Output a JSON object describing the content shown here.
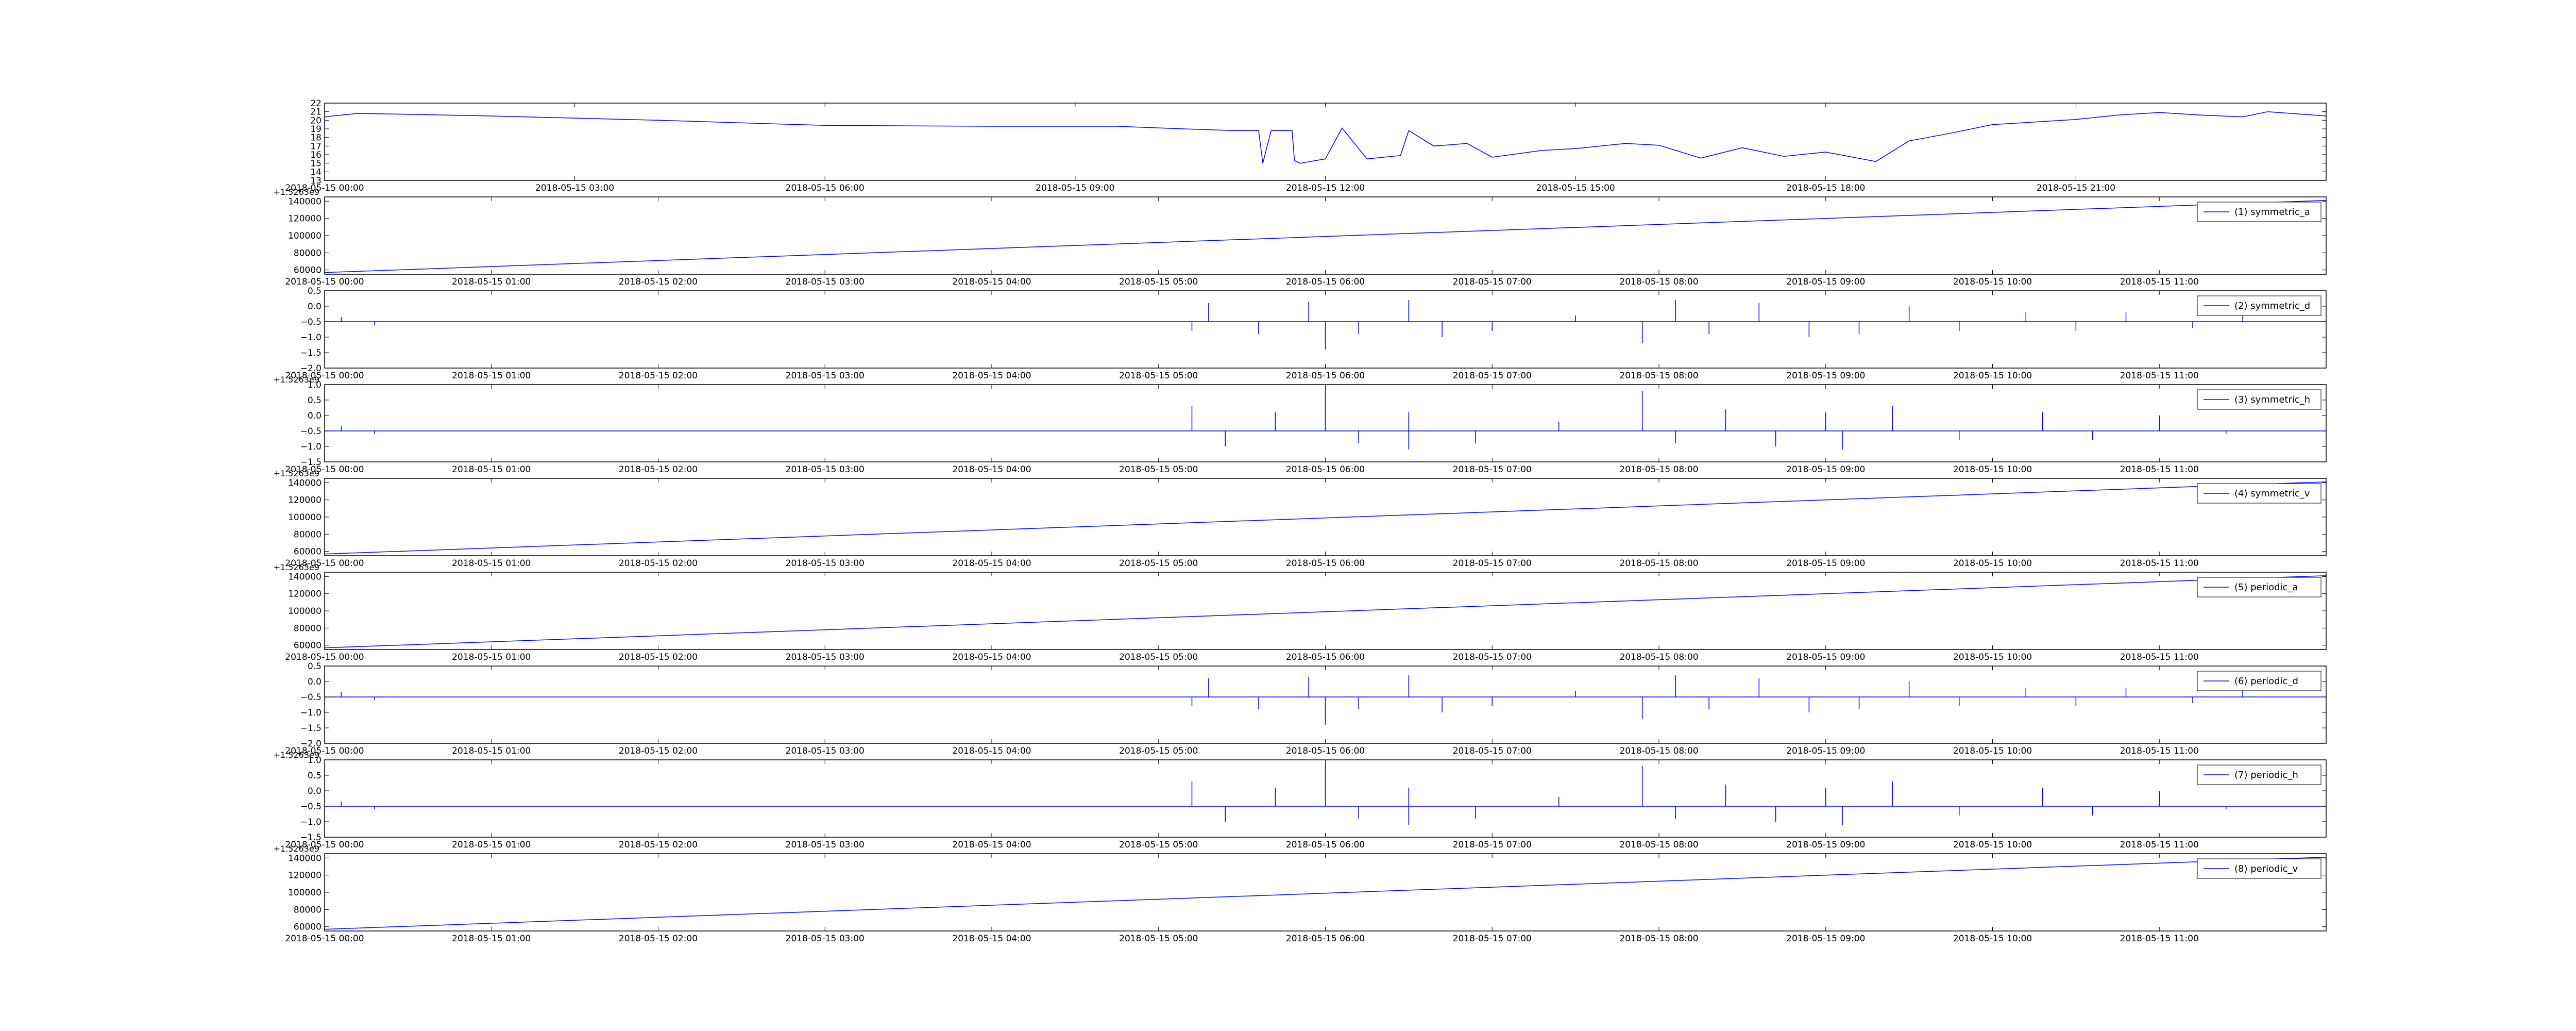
{
  "chart_data": [
    {
      "type": "line",
      "color": "#0000ff",
      "yticks": [
        "13",
        "14",
        "15",
        "16",
        "17",
        "18",
        "19",
        "20",
        "21",
        "22"
      ],
      "ylim": [
        13,
        22
      ],
      "xticks": [
        "2018-05-15 00:00",
        "2018-05-15 03:00",
        "2018-05-15 06:00",
        "2018-05-15 09:00",
        "2018-05-15 12:00",
        "2018-05-15 15:00",
        "2018-05-15 18:00",
        "2018-05-15 21:00"
      ],
      "x_hours": [
        0,
        24
      ],
      "offset_text": "",
      "series": [
        {
          "x": [
            0,
            0.4,
            1,
            2,
            4,
            6,
            8,
            9.5,
            10.3,
            10.9,
            11.2,
            11.25,
            11.35,
            11.6,
            11.63,
            11.7,
            12,
            12.2,
            12.5,
            12.9,
            13,
            13.3,
            13.7,
            14,
            14.6,
            15,
            15.6,
            16,
            16.5,
            17,
            17.5,
            18,
            18.6,
            19,
            19.5,
            20,
            20.5,
            21,
            21.5,
            22,
            22.5,
            23,
            23.3,
            24
          ],
          "y": [
            20.4,
            20.8,
            20.7,
            20.5,
            20.0,
            19.4,
            19.3,
            19.3,
            19.0,
            18.8,
            18.8,
            15.0,
            18.8,
            18.8,
            15.3,
            15.0,
            15.5,
            19.1,
            15.5,
            15.9,
            18.8,
            17.0,
            17.3,
            15.7,
            16.5,
            16.7,
            17.3,
            17.1,
            15.6,
            16.8,
            15.8,
            16.3,
            15.2,
            17.6,
            18.5,
            19.5,
            19.8,
            20.1,
            20.6,
            20.9,
            20.6,
            20.4,
            21.0,
            20.5
          ]
        }
      ],
      "legend": ""
    },
    {
      "type": "line",
      "color": "#0000ff",
      "yticks": [
        "60000",
        "80000",
        "100000",
        "120000",
        "140000"
      ],
      "ylim": [
        55000,
        145000
      ],
      "xticks": [
        "2018-05-15 00:00",
        "2018-05-15 01:00",
        "2018-05-15 02:00",
        "2018-05-15 03:00",
        "2018-05-15 04:00",
        "2018-05-15 05:00",
        "2018-05-15 06:00",
        "2018-05-15 07:00",
        "2018-05-15 08:00",
        "2018-05-15 09:00",
        "2018-05-15 10:00",
        "2018-05-15 11:00"
      ],
      "x_hours": [
        0,
        12
      ],
      "offset_text": "+1.5263e9",
      "series": [
        {
          "name": "(1) symmetric_a",
          "x": [
            0,
            12
          ],
          "y": [
            57000,
            141000
          ]
        }
      ],
      "legend": "(1) symmetric_a"
    },
    {
      "type": "line",
      "color": "#0000ff",
      "yticks": [
        "0.5",
        "0.0",
        "−0.5",
        "−1.0",
        "−1.5",
        "−2.0"
      ],
      "ylim": [
        -2.0,
        0.5
      ],
      "xticks": [
        "2018-05-15 00:00",
        "2018-05-15 01:00",
        "2018-05-15 02:00",
        "2018-05-15 03:00",
        "2018-05-15 04:00",
        "2018-05-15 05:00",
        "2018-05-15 06:00",
        "2018-05-15 07:00",
        "2018-05-15 08:00",
        "2018-05-15 09:00",
        "2018-05-15 10:00",
        "2018-05-15 11:00"
      ],
      "x_hours": [
        0,
        12
      ],
      "offset_text": "",
      "series": [
        {
          "name": "(2) symmetric_d",
          "x": [
            0,
            12
          ],
          "y": [
            -0.5,
            -0.5
          ]
        }
      ],
      "spikes": [
        [
          0.1,
          -0.35
        ],
        [
          0.3,
          -0.6
        ],
        [
          5.2,
          -0.8
        ],
        [
          5.3,
          0.1
        ],
        [
          5.6,
          -0.9
        ],
        [
          5.9,
          0.15
        ],
        [
          6.0,
          -1.4
        ],
        [
          6.2,
          -0.9
        ],
        [
          6.5,
          0.2
        ],
        [
          6.7,
          -1.0
        ],
        [
          7.0,
          -0.8
        ],
        [
          7.5,
          -0.3
        ],
        [
          7.9,
          -1.2
        ],
        [
          8.1,
          0.2
        ],
        [
          8.3,
          -0.9
        ],
        [
          8.6,
          0.1
        ],
        [
          8.9,
          -1.0
        ],
        [
          9.2,
          -0.9
        ],
        [
          9.5,
          0.0
        ],
        [
          9.8,
          -0.8
        ],
        [
          10.2,
          -0.2
        ],
        [
          10.5,
          -0.8
        ],
        [
          10.8,
          -0.2
        ],
        [
          11.2,
          -0.7
        ],
        [
          11.5,
          -0.3
        ]
      ],
      "legend": "(2) symmetric_d"
    },
    {
      "type": "line",
      "color": "#0000ff",
      "yticks": [
        "1.0",
        "0.5",
        "0.0",
        "−0.5",
        "−1.0",
        "−1.5"
      ],
      "ylim": [
        -1.5,
        1.0
      ],
      "xticks": [
        "2018-05-15 00:00",
        "2018-05-15 01:00",
        "2018-05-15 02:00",
        "2018-05-15 03:00",
        "2018-05-15 04:00",
        "2018-05-15 05:00",
        "2018-05-15 06:00",
        "2018-05-15 07:00",
        "2018-05-15 08:00",
        "2018-05-15 09:00",
        "2018-05-15 10:00",
        "2018-05-15 11:00"
      ],
      "x_hours": [
        0,
        12
      ],
      "offset_text": "+1.5263e9",
      "series": [
        {
          "name": "(3) symmetric_h",
          "x": [
            0,
            12
          ],
          "y": [
            -0.5,
            -0.5
          ]
        }
      ],
      "spikes": [
        [
          0.1,
          -0.35
        ],
        [
          0.3,
          -0.6
        ],
        [
          5.2,
          0.3
        ],
        [
          5.4,
          -1.0
        ],
        [
          5.7,
          0.1
        ],
        [
          6.0,
          0.9
        ],
        [
          6.2,
          -0.9
        ],
        [
          6.5,
          0.1
        ],
        [
          6.5,
          -1.1
        ],
        [
          6.9,
          -0.9
        ],
        [
          7.4,
          -0.2
        ],
        [
          7.9,
          0.8
        ],
        [
          8.1,
          -0.9
        ],
        [
          8.4,
          0.2
        ],
        [
          8.7,
          -1.0
        ],
        [
          9.0,
          0.1
        ],
        [
          9.1,
          -1.1
        ],
        [
          9.4,
          0.3
        ],
        [
          9.8,
          -0.8
        ],
        [
          10.3,
          0.1
        ],
        [
          10.6,
          -0.8
        ],
        [
          11.0,
          0.0
        ],
        [
          11.4,
          -0.6
        ]
      ],
      "legend": "(3) symmetric_h"
    },
    {
      "type": "line",
      "color": "#0000ff",
      "yticks": [
        "60000",
        "80000",
        "100000",
        "120000",
        "140000"
      ],
      "ylim": [
        55000,
        145000
      ],
      "xticks": [
        "2018-05-15 00:00",
        "2018-05-15 01:00",
        "2018-05-15 02:00",
        "2018-05-15 03:00",
        "2018-05-15 04:00",
        "2018-05-15 05:00",
        "2018-05-15 06:00",
        "2018-05-15 07:00",
        "2018-05-15 08:00",
        "2018-05-15 09:00",
        "2018-05-15 10:00",
        "2018-05-15 11:00"
      ],
      "x_hours": [
        0,
        12
      ],
      "offset_text": "+1.5263e9",
      "series": [
        {
          "name": "(4) symmetric_v",
          "x": [
            0,
            12
          ],
          "y": [
            57000,
            141000
          ]
        }
      ],
      "legend": "(4) symmetric_v"
    },
    {
      "type": "line",
      "color": "#0000ff",
      "yticks": [
        "60000",
        "80000",
        "100000",
        "120000",
        "140000"
      ],
      "ylim": [
        55000,
        145000
      ],
      "xticks": [
        "2018-05-15 00:00",
        "2018-05-15 01:00",
        "2018-05-15 02:00",
        "2018-05-15 03:00",
        "2018-05-15 04:00",
        "2018-05-15 05:00",
        "2018-05-15 06:00",
        "2018-05-15 07:00",
        "2018-05-15 08:00",
        "2018-05-15 09:00",
        "2018-05-15 10:00",
        "2018-05-15 11:00"
      ],
      "x_hours": [
        0,
        12
      ],
      "offset_text": "+1.5263e9",
      "series": [
        {
          "name": "(5) periodic_a",
          "x": [
            0,
            12
          ],
          "y": [
            57000,
            141000
          ]
        }
      ],
      "legend": "(5) periodic_a"
    },
    {
      "type": "line",
      "color": "#0000ff",
      "yticks": [
        "0.5",
        "0.0",
        "−0.5",
        "−1.0",
        "−1.5",
        "−2.0"
      ],
      "ylim": [
        -2.0,
        0.5
      ],
      "xticks": [
        "2018-05-15 00:00",
        "2018-05-15 01:00",
        "2018-05-15 02:00",
        "2018-05-15 03:00",
        "2018-05-15 04:00",
        "2018-05-15 05:00",
        "2018-05-15 06:00",
        "2018-05-15 07:00",
        "2018-05-15 08:00",
        "2018-05-15 09:00",
        "2018-05-15 10:00",
        "2018-05-15 11:00"
      ],
      "x_hours": [
        0,
        12
      ],
      "offset_text": "",
      "series": [
        {
          "name": "(6) periodic_d",
          "x": [
            0,
            12
          ],
          "y": [
            -0.5,
            -0.5
          ]
        }
      ],
      "spikes": [
        [
          0.1,
          -0.35
        ],
        [
          0.3,
          -0.6
        ],
        [
          5.2,
          -0.8
        ],
        [
          5.3,
          0.1
        ],
        [
          5.6,
          -0.9
        ],
        [
          5.9,
          0.15
        ],
        [
          6.0,
          -1.4
        ],
        [
          6.2,
          -0.9
        ],
        [
          6.5,
          0.2
        ],
        [
          6.7,
          -1.0
        ],
        [
          7.0,
          -0.8
        ],
        [
          7.5,
          -0.3
        ],
        [
          7.9,
          -1.2
        ],
        [
          8.1,
          0.2
        ],
        [
          8.3,
          -0.9
        ],
        [
          8.6,
          0.1
        ],
        [
          8.9,
          -1.0
        ],
        [
          9.2,
          -0.9
        ],
        [
          9.5,
          0.0
        ],
        [
          9.8,
          -0.8
        ],
        [
          10.2,
          -0.2
        ],
        [
          10.5,
          -0.8
        ],
        [
          10.8,
          -0.2
        ],
        [
          11.2,
          -0.7
        ],
        [
          11.5,
          -0.3
        ]
      ],
      "legend": "(6) periodic_d"
    },
    {
      "type": "line",
      "color": "#0000ff",
      "yticks": [
        "1.0",
        "0.5",
        "0.0",
        "−0.5",
        "−1.0",
        "−1.5"
      ],
      "ylim": [
        -1.5,
        1.0
      ],
      "xticks": [
        "2018-05-15 00:00",
        "2018-05-15 01:00",
        "2018-05-15 02:00",
        "2018-05-15 03:00",
        "2018-05-15 04:00",
        "2018-05-15 05:00",
        "2018-05-15 06:00",
        "2018-05-15 07:00",
        "2018-05-15 08:00",
        "2018-05-15 09:00",
        "2018-05-15 10:00",
        "2018-05-15 11:00"
      ],
      "x_hours": [
        0,
        12
      ],
      "offset_text": "+1.5263e9",
      "series": [
        {
          "name": "(7) periodic_h",
          "x": [
            0,
            12
          ],
          "y": [
            -0.5,
            -0.5
          ]
        }
      ],
      "spikes": [
        [
          0.1,
          -0.35
        ],
        [
          0.3,
          -0.6
        ],
        [
          5.2,
          0.3
        ],
        [
          5.4,
          -1.0
        ],
        [
          5.7,
          0.1
        ],
        [
          6.0,
          0.9
        ],
        [
          6.2,
          -0.9
        ],
        [
          6.5,
          0.1
        ],
        [
          6.5,
          -1.1
        ],
        [
          6.9,
          -0.9
        ],
        [
          7.4,
          -0.2
        ],
        [
          7.9,
          0.8
        ],
        [
          8.1,
          -0.9
        ],
        [
          8.4,
          0.2
        ],
        [
          8.7,
          -1.0
        ],
        [
          9.0,
          0.1
        ],
        [
          9.1,
          -1.1
        ],
        [
          9.4,
          0.3
        ],
        [
          9.8,
          -0.8
        ],
        [
          10.3,
          0.1
        ],
        [
          10.6,
          -0.8
        ],
        [
          11.0,
          0.0
        ],
        [
          11.4,
          -0.6
        ]
      ],
      "legend": "(7) periodic_h"
    },
    {
      "type": "line",
      "color": "#0000ff",
      "yticks": [
        "60000",
        "80000",
        "100000",
        "120000",
        "140000"
      ],
      "ylim": [
        55000,
        145000
      ],
      "xticks": [
        "2018-05-15 00:00",
        "2018-05-15 01:00",
        "2018-05-15 02:00",
        "2018-05-15 03:00",
        "2018-05-15 04:00",
        "2018-05-15 05:00",
        "2018-05-15 06:00",
        "2018-05-15 07:00",
        "2018-05-15 08:00",
        "2018-05-15 09:00",
        "2018-05-15 10:00",
        "2018-05-15 11:00"
      ],
      "x_hours": [
        0,
        12
      ],
      "offset_text": "+1.5263e9",
      "series": [
        {
          "name": "(8) periodic_v",
          "x": [
            0,
            12
          ],
          "y": [
            57000,
            141000
          ]
        }
      ],
      "legend": "(8) periodic_v"
    }
  ]
}
